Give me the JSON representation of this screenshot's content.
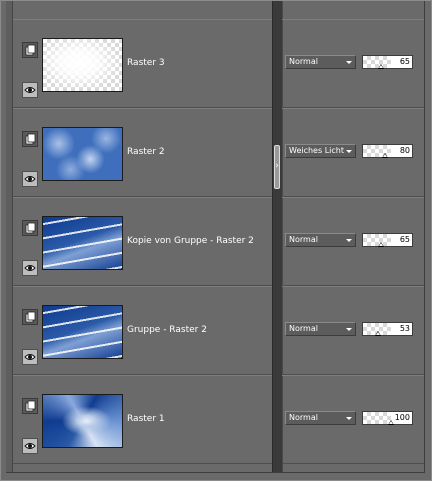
{
  "layers": [
    {
      "name": "Raster 3",
      "blend_mode": "Normal",
      "opacity": "65",
      "opacity_level": 0.65,
      "thumbnail": "white-glow-on-transparent"
    },
    {
      "name": "Raster 2",
      "blend_mode": "Weiches Licht",
      "opacity": "80",
      "opacity_level": 0.8,
      "thumbnail": "blue-clouds"
    },
    {
      "name": "Kopie von Gruppe - Raster 2",
      "blend_mode": "Normal",
      "opacity": "65",
      "opacity_level": 0.65,
      "thumbnail": "blue-wave-dots"
    },
    {
      "name": "Gruppe - Raster 2",
      "blend_mode": "Normal",
      "opacity": "53",
      "opacity_level": 0.53,
      "thumbnail": "blue-wave-dots"
    },
    {
      "name": "Raster 1",
      "blend_mode": "Normal",
      "opacity": "100",
      "opacity_level": 1.0,
      "thumbnail": "blue-swirl"
    }
  ],
  "icons": {
    "page": "layer-page-icon",
    "eye": "visibility-eye-icon",
    "dropdown": "chevron-down-icon",
    "splitter": "chevron-right-icon"
  },
  "splitter_glyph": "›",
  "colors": {
    "panel_bg": "#6a6a6a",
    "splitter": "#3a3a3a",
    "accent_blue": "#2a5aa8"
  }
}
